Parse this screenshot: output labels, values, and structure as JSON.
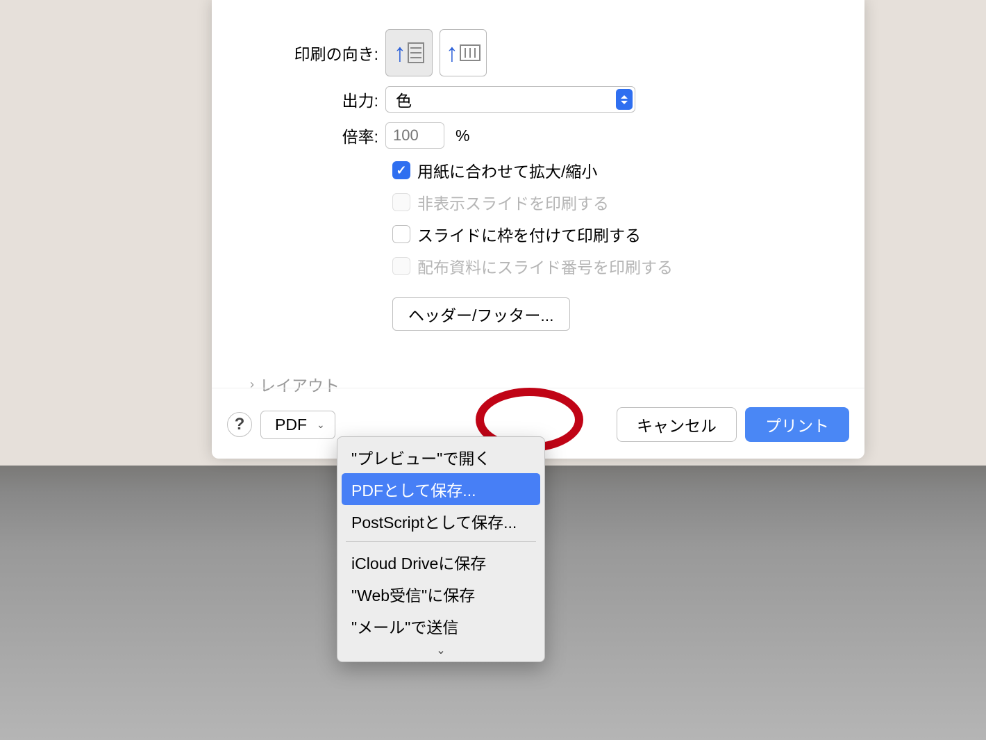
{
  "form": {
    "orientation_label": "印刷の向き:",
    "output_label": "出力:",
    "output_value": "色",
    "scale_label": "倍率:",
    "scale_value": "100",
    "scale_suffix": "%"
  },
  "checkboxes": {
    "fit_to_paper": "用紙に合わせて拡大/縮小",
    "print_hidden": "非表示スライドを印刷する",
    "print_frame": "スライドに枠を付けて印刷する",
    "print_slide_number": "配布資料にスライド番号を印刷する"
  },
  "header_footer_btn": "ヘッダー/フッター...",
  "disclosure": "レイアウト",
  "bottom": {
    "help": "?",
    "pdf_label": "PDF",
    "cancel": "キャンセル",
    "print": "プリント"
  },
  "menu": {
    "open_preview": "\"プレビュー\"で開く",
    "save_as_pdf": "PDFとして保存...",
    "save_as_postscript": "PostScriptとして保存...",
    "save_icloud": "iCloud Driveに保存",
    "save_web": "\"Web受信\"に保存",
    "send_mail": "\"メール\"で送信"
  }
}
